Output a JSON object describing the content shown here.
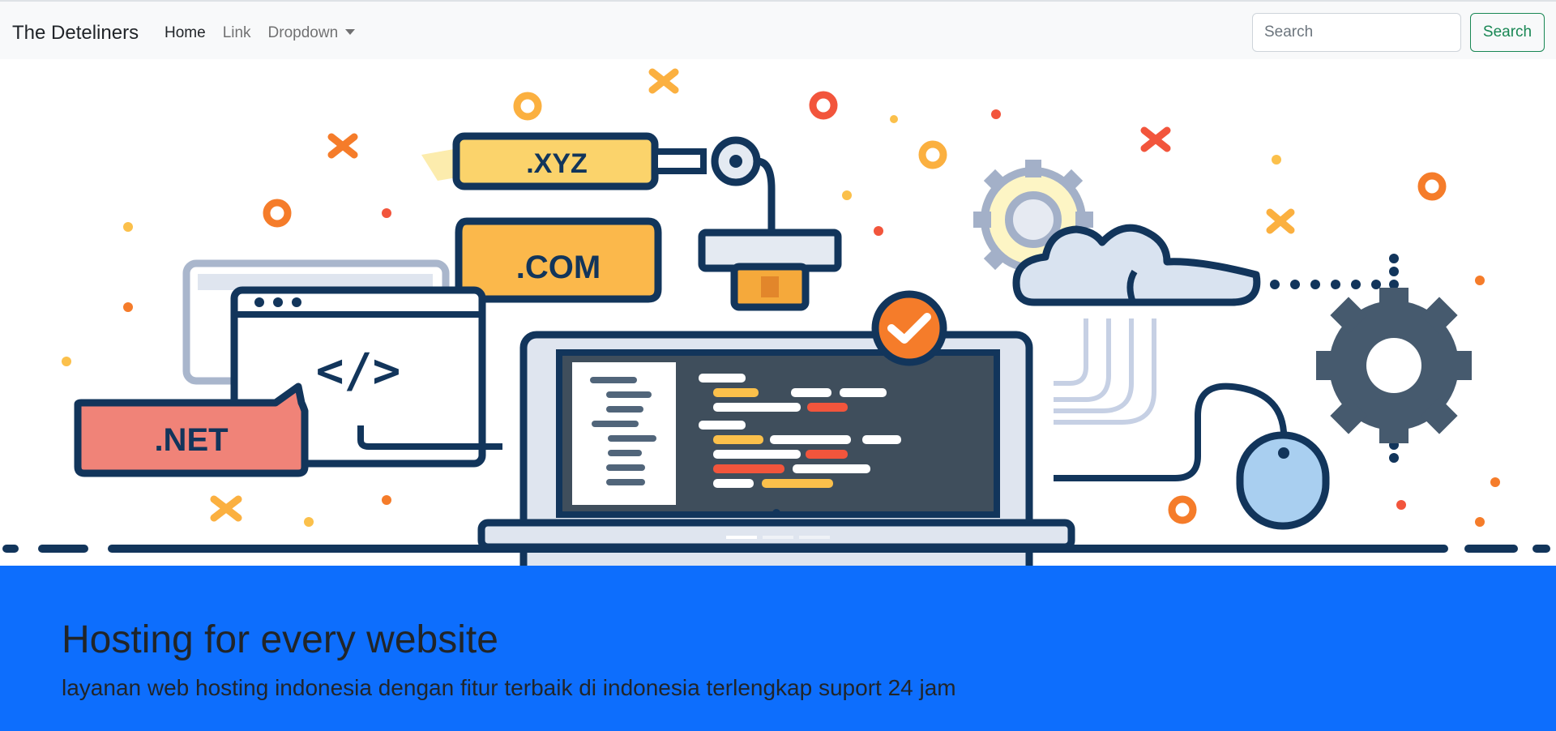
{
  "navbar": {
    "brand": "The Deteliners",
    "links": [
      {
        "label": "Home",
        "active": true
      },
      {
        "label": "Link",
        "active": false
      },
      {
        "label": "Dropdown",
        "active": false
      }
    ],
    "search": {
      "placeholder": "Search",
      "value": ""
    },
    "search_button": "Search"
  },
  "hero": {
    "illustration": {
      "tld_labels": [
        ".XYZ",
        ".COM",
        ".NET"
      ],
      "code_symbol": "</>"
    },
    "carousel_indicators": 3,
    "active_indicator": 0
  },
  "jumbotron": {
    "title": "Hosting for every website",
    "text": "layanan web hosting indonesia dengan fitur terbaik di indonesia terlengkap suport 24 jam"
  },
  "colors": {
    "navbar_bg": "#f8f9fa",
    "jumbotron_bg": "#0d6efd",
    "success": "#198754",
    "navy": "#12355b",
    "orange": "#f57c2a",
    "yellow": "#fbc04b",
    "red": "#f08378"
  }
}
